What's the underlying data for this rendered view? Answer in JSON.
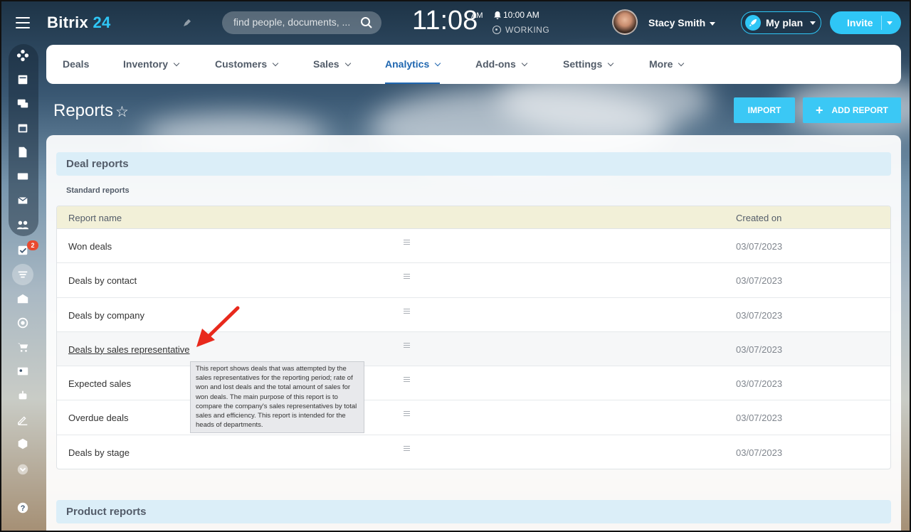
{
  "app": {
    "logo_main": "Bitrix",
    "logo_num": "24"
  },
  "header": {
    "search_placeholder": "find people, documents, ...",
    "clock": "11:08",
    "ampm": "AM",
    "alarm": "10:00 AM",
    "status": "WORKING",
    "user_name": "Stacy Smith",
    "plan_label": "My plan",
    "invite_label": "Invite"
  },
  "sidebar": {
    "icons": [
      "activity-stream-icon",
      "news-icon",
      "chat-icon",
      "calendar-icon",
      "documents-icon",
      "drive-icon",
      "mail-icon",
      "groups-icon",
      "tasks-icon",
      "crm-funnel-icon",
      "company-icon",
      "target-icon",
      "shop-icon",
      "contact-center-icon",
      "robot-icon",
      "signature-icon",
      "box-icon",
      "more-icon",
      "help-icon"
    ],
    "tasks_badge": "2"
  },
  "nav": {
    "items": [
      {
        "label": "Deals",
        "has_menu": false
      },
      {
        "label": "Inventory",
        "has_menu": true
      },
      {
        "label": "Customers",
        "has_menu": true
      },
      {
        "label": "Sales",
        "has_menu": true
      },
      {
        "label": "Analytics",
        "has_menu": true,
        "active": true
      },
      {
        "label": "Add-ons",
        "has_menu": true
      },
      {
        "label": "Settings",
        "has_menu": true
      },
      {
        "label": "More",
        "has_menu": true
      }
    ]
  },
  "page": {
    "title": "Reports",
    "import_label": "IMPORT",
    "add_report_label": "ADD REPORT"
  },
  "deal_reports": {
    "title": "Deal reports",
    "subtitle": "Standard reports",
    "columns": [
      "Report name",
      "Created on"
    ],
    "rows": [
      {
        "name": "Won deals",
        "date": "03/07/2023"
      },
      {
        "name": "Deals by contact",
        "date": "03/07/2023"
      },
      {
        "name": "Deals by company",
        "date": "03/07/2023"
      },
      {
        "name": "Deals by sales representative",
        "date": "03/07/2023"
      },
      {
        "name": "Expected sales",
        "date": "03/07/2023"
      },
      {
        "name": "Overdue deals",
        "date": "03/07/2023"
      },
      {
        "name": "Deals by stage",
        "date": "03/07/2023"
      }
    ],
    "tooltip": "This report shows deals that was attempted by the sales representatives for the reporting period; rate of won and lost deals and the total amount of sales for won deals. The main purpose of this report is to compare the company's sales representatives by total sales and efficiency. This report is intended for the heads of departments."
  },
  "product_reports": {
    "title": "Product reports"
  },
  "colors": {
    "accent": "#2fc6f6",
    "nav_active": "#2067b0",
    "section_bg": "#dbeef8",
    "table_head_bg": "#f2f0d8",
    "badge": "#e9492f",
    "arrow": "#e8291c"
  }
}
